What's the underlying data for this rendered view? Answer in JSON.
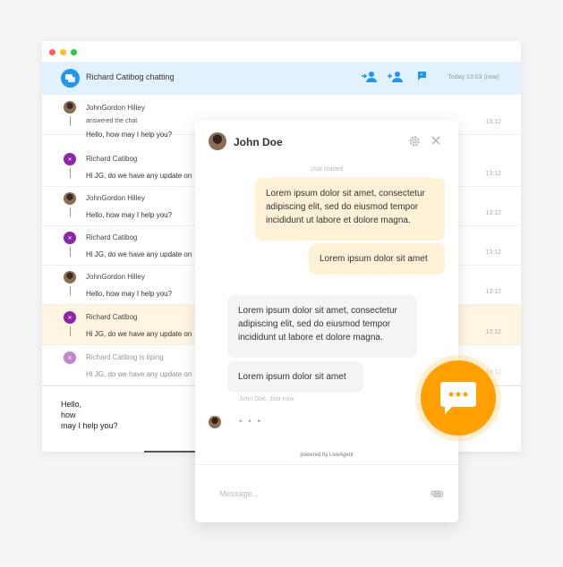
{
  "window": {
    "controls": [
      "#ff5f57",
      "#ffbd2e",
      "#28c840"
    ]
  },
  "header": {
    "title": "Richard Catibog chatting",
    "time": "Today 13:03 (now)",
    "accent": "#2196f3",
    "icons": [
      "transfer-chat-icon",
      "invite-agent-icon",
      "flag-icon"
    ]
  },
  "conversation": [
    {
      "name": "JohnGordon Hilley",
      "sub": "answered the chat",
      "text": "Hello, how may I help you?",
      "time": "13:12",
      "avatar": "photo"
    },
    {
      "name": "Richard Catibog",
      "text": "Hi JG, do we have any update on",
      "time": "13:12",
      "avatar": "purple"
    },
    {
      "name": "JohnGordon Hilley",
      "text": "Hello, how may I help you?",
      "time": "13:12",
      "avatar": "photo"
    },
    {
      "name": "Richard Catibog",
      "text": "Hi JG, do we have any update on",
      "time": "13:12",
      "avatar": "purple"
    },
    {
      "name": "JohnGordon Hilley",
      "text": "Hello, how may I help you?",
      "time": "13:12",
      "avatar": "photo"
    },
    {
      "name": "Richard Catibog",
      "text": "Hi JG, do we have any update on",
      "time": "13:12",
      "avatar": "purple"
    },
    {
      "name": "Richard Catibog is tiping",
      "text": "Hi JG, do we have any update on",
      "time": "13:12",
      "avatar": "purple"
    }
  ],
  "compose": {
    "lines": [
      "Hello,",
      "how",
      "may I help you?"
    ]
  },
  "widget": {
    "name": "John Doe",
    "system": "chat started",
    "messages": [
      {
        "dir": "out",
        "text": "Lorem ipsum dolor sit amet, consectetur adipiscing elit, sed do eiusmod tempor incididunt ut labore et dolore magna."
      },
      {
        "dir": "out",
        "text": "Lorem ipsum dolor sit amet"
      },
      {
        "dir": "in",
        "text": "Lorem ipsum dolor sit amet, consectetur adipiscing elit, sed do eiusmod tempor incididunt ut labore et dolore magna."
      },
      {
        "dir": "in",
        "text": "Lorem ipsum dolor sit amet"
      }
    ],
    "meta": "John Doe, Just now",
    "typing": "• • •",
    "powered": "powered by LiveAgent",
    "placeholder": "Message...",
    "out_color": "#fff1d6",
    "in_color": "#f4f4f4"
  },
  "launcher": {
    "color": "#ffa000",
    "icon": "chat-bubble-icon"
  }
}
